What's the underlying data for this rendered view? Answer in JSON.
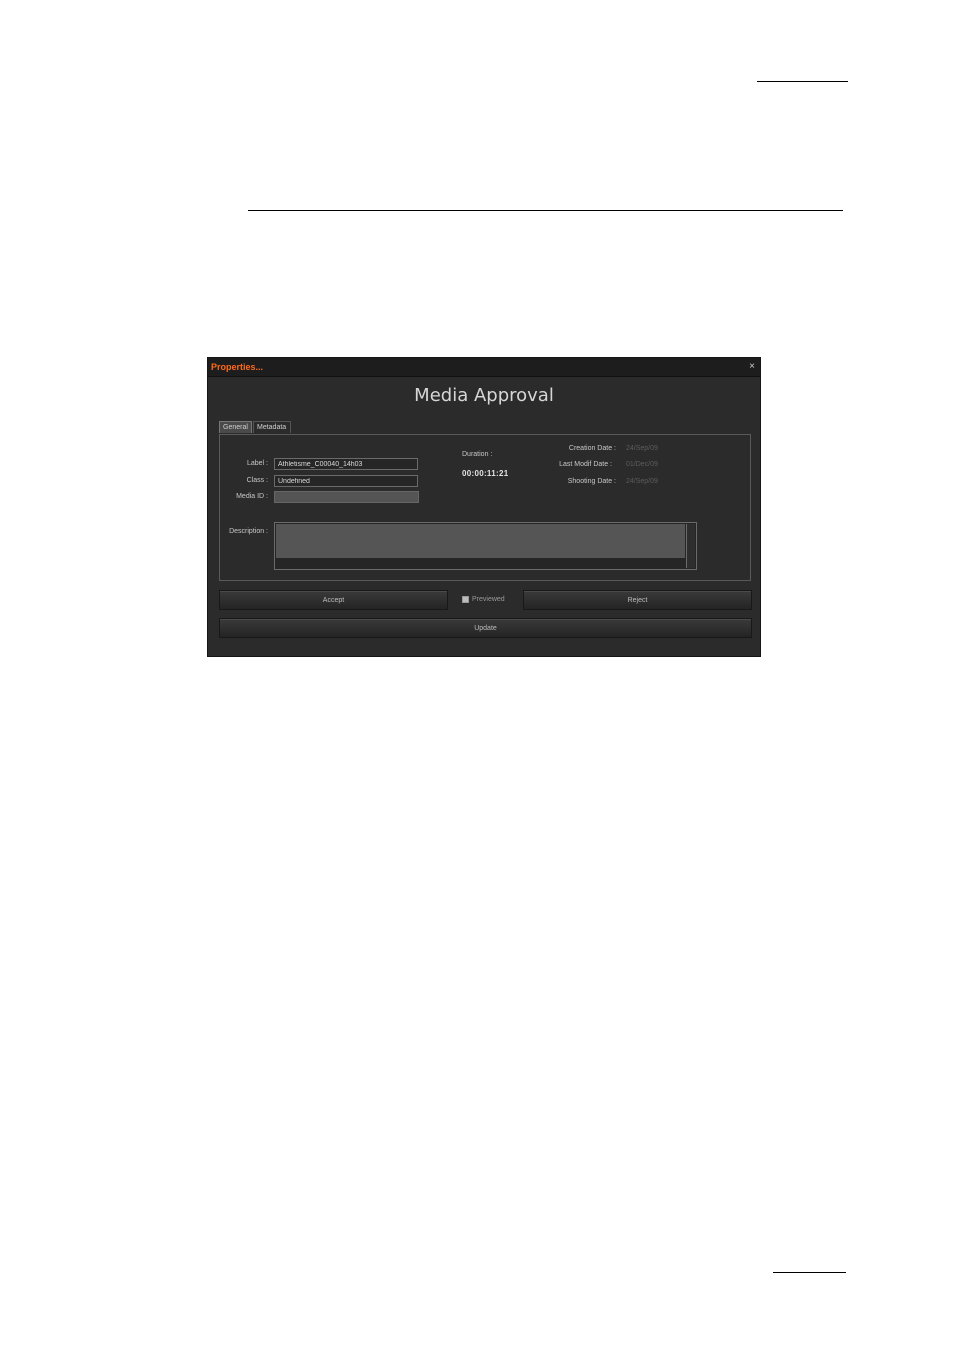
{
  "dialog": {
    "window_title": "Properties...",
    "close_glyph": "×",
    "heading": "Media Approval",
    "tabs": [
      {
        "label": "General",
        "active": true
      },
      {
        "label": "Metadata",
        "active": false
      }
    ],
    "fields": {
      "label_caption": "Label :",
      "label_value": "Athletisme_C00040_14h03",
      "class_caption": "Class :",
      "class_value": "Undefined",
      "media_id_caption": "Media ID :",
      "media_id_value": "",
      "description_caption": "Description :",
      "description_value": ""
    },
    "duration": {
      "caption": "Duration :",
      "value": "00:00:11:21"
    },
    "dates": {
      "creation_caption": "Creation Date :",
      "creation_value": "24/Sep/09",
      "last_modif_caption": "Last Modif Date :",
      "last_modif_value": "01/Dec/09",
      "shooting_caption": "Shooting Date :",
      "shooting_value": "24/Sep/09"
    },
    "actions": {
      "accept_label": "Accept",
      "previewed_label": "Previewed",
      "previewed_checked": false,
      "reject_label": "Reject",
      "update_label": "Update"
    },
    "colors": {
      "title_accent": "#ff6a1a",
      "background": "#2b2b2b"
    }
  }
}
